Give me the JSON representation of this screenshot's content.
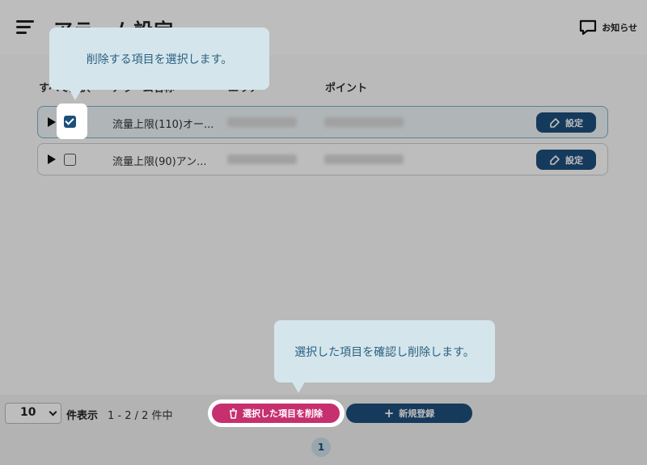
{
  "header": {
    "title": "アラーム設定",
    "notice_label": "お知らせ"
  },
  "columns": {
    "select_all": "すべて選択",
    "alarm_name": "アラーム名称",
    "area": "エリア",
    "point": "ポイント"
  },
  "rows": [
    {
      "name": "流量上限(110)オー...",
      "selected": true,
      "settings_label": "設定"
    },
    {
      "name": "流量上限(90)アン...",
      "selected": false,
      "settings_label": "設定"
    }
  ],
  "footer": {
    "per_page_value": "10",
    "per_page_label": "件表示",
    "count_label": "1 - 2 / 2 件中",
    "delete_label": "選択した項目を削除",
    "new_label": "新規登録",
    "current_page": "1"
  },
  "tooltips": {
    "select_hint": "削除する項目を選択します。",
    "delete_hint": "選択した項目を確認し削除します。"
  },
  "colors": {
    "primary": "#1d4f7c",
    "danger": "#c6306f",
    "tooltip_bg": "#d4e6ec",
    "tooltip_text": "#2b5f80"
  }
}
